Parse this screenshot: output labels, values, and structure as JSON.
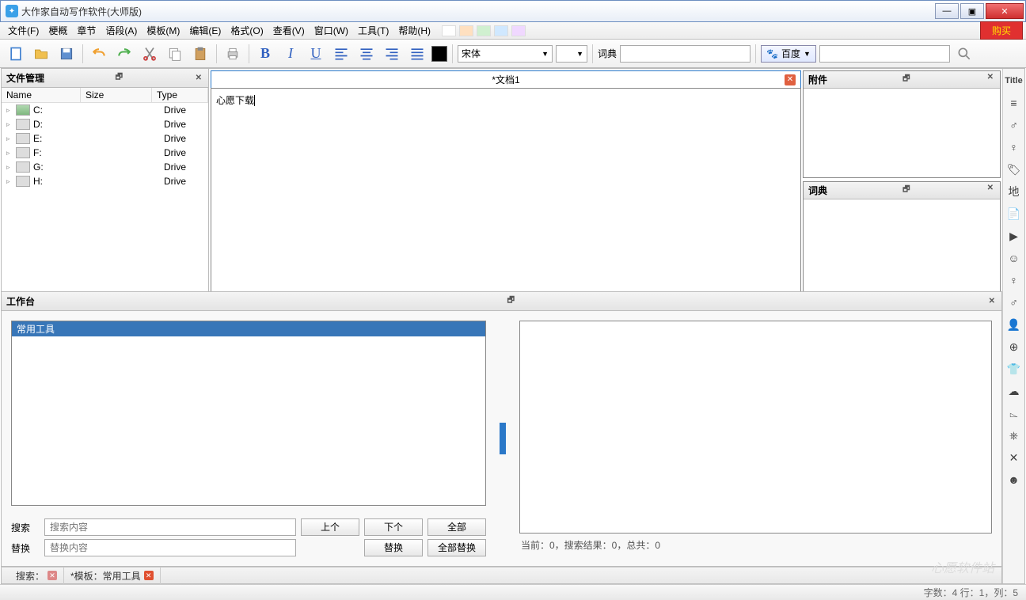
{
  "window": {
    "title": "大作家自动写作软件(大师版)"
  },
  "menu": {
    "file": "文件(F)",
    "outline": "梗概",
    "chapter": "章节",
    "segment": "语段(A)",
    "template": "模板(M)",
    "edit": "编辑(E)",
    "format": "格式(O)",
    "view": "查看(V)",
    "window": "窗口(W)",
    "tools": "工具(T)",
    "help": "帮助(H)",
    "buy": "购买"
  },
  "toolbar": {
    "font": "宋体",
    "dict_label": "词典",
    "search_engine": "百度"
  },
  "filemgr": {
    "title": "文件管理",
    "cols": {
      "name": "Name",
      "size": "Size",
      "type": "Type"
    },
    "drives": [
      {
        "name": "C:",
        "type": "Drive",
        "special": true
      },
      {
        "name": "D:",
        "type": "Drive"
      },
      {
        "name": "E:",
        "type": "Drive"
      },
      {
        "name": "F:",
        "type": "Drive"
      },
      {
        "name": "G:",
        "type": "Drive"
      },
      {
        "name": "H:",
        "type": "Drive"
      }
    ]
  },
  "editor": {
    "tab_title": "*文档1",
    "content": "心愿下载"
  },
  "right": {
    "attach": "附件",
    "dict": "词典"
  },
  "side": {
    "title": "Title",
    "di": "地"
  },
  "workbench": {
    "title": "工作台",
    "list_item": "常用工具",
    "search_label": "搜索",
    "search_ph": "搜索内容",
    "replace_label": "替换",
    "replace_ph": "替换内容",
    "btn_prev": "上个",
    "btn_next": "下个",
    "btn_all": "全部",
    "btn_replace": "替换",
    "btn_replace_all": "全部替换",
    "status": "当前：0，搜索结果：0，总共：0"
  },
  "bottom": {
    "search": "搜索：",
    "tab2": "*模板：常用工具"
  },
  "status": {
    "info": "字数：4 行：1，列：5"
  },
  "watermark": "心愿软件站"
}
